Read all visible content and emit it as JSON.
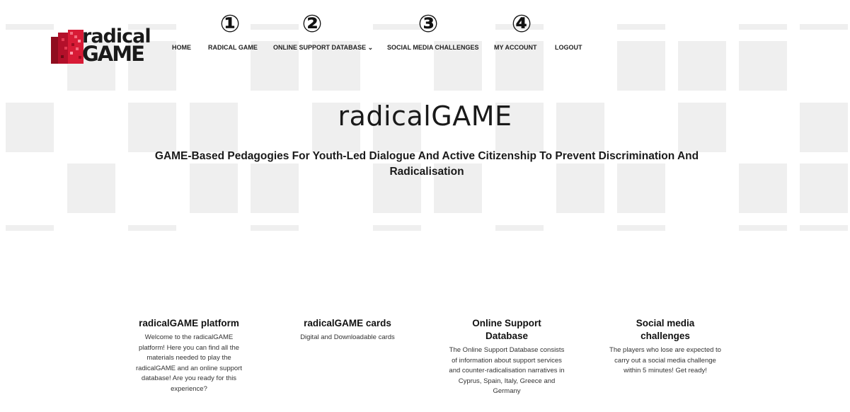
{
  "header": {
    "logo": {
      "line1": "radical",
      "line2": "GAME",
      "brand_color": "#c8102e"
    },
    "nav": [
      {
        "label": "HOME",
        "marker": ""
      },
      {
        "label": "RADICAL GAME",
        "marker": "①"
      },
      {
        "label": "ONLINE SUPPORT DATABASE ⌄",
        "marker": "②"
      },
      {
        "label": "SOCIAL MEDIA CHALLENGES",
        "marker": "③"
      },
      {
        "label": "MY ACCOUNT",
        "marker": "④"
      },
      {
        "label": "LOGOUT",
        "marker": ""
      }
    ]
  },
  "hero": {
    "title": "radicalGAME",
    "subtitle": "GAME-Based Pedagogies For Youth-Led Dialogue And Active Citizenship To Prevent Discrimination And Radicalisation"
  },
  "features": [
    {
      "title": "radicalGAME platform",
      "description": "Welcome to the radicalGAME platform! Here you can find all the materials needed to play the radicalGAME and an online support database! Are you ready for this experience?"
    },
    {
      "title": "radicalGAME cards",
      "description": "Digital and Downloadable cards"
    },
    {
      "title": "Online Support Database",
      "description": "The Online Support Database consists of information about support services and counter-radicalisation narratives in Cyprus, Spain, Italy, Greece and Germany"
    },
    {
      "title": "Social media challenges",
      "description": "The players who lose are expected to carry out a social media challenge within 5 minutes! Get ready!"
    }
  ],
  "colors": {
    "background": "#ffffff",
    "grid_square": "#efefef",
    "text": "#1a1a1a"
  }
}
